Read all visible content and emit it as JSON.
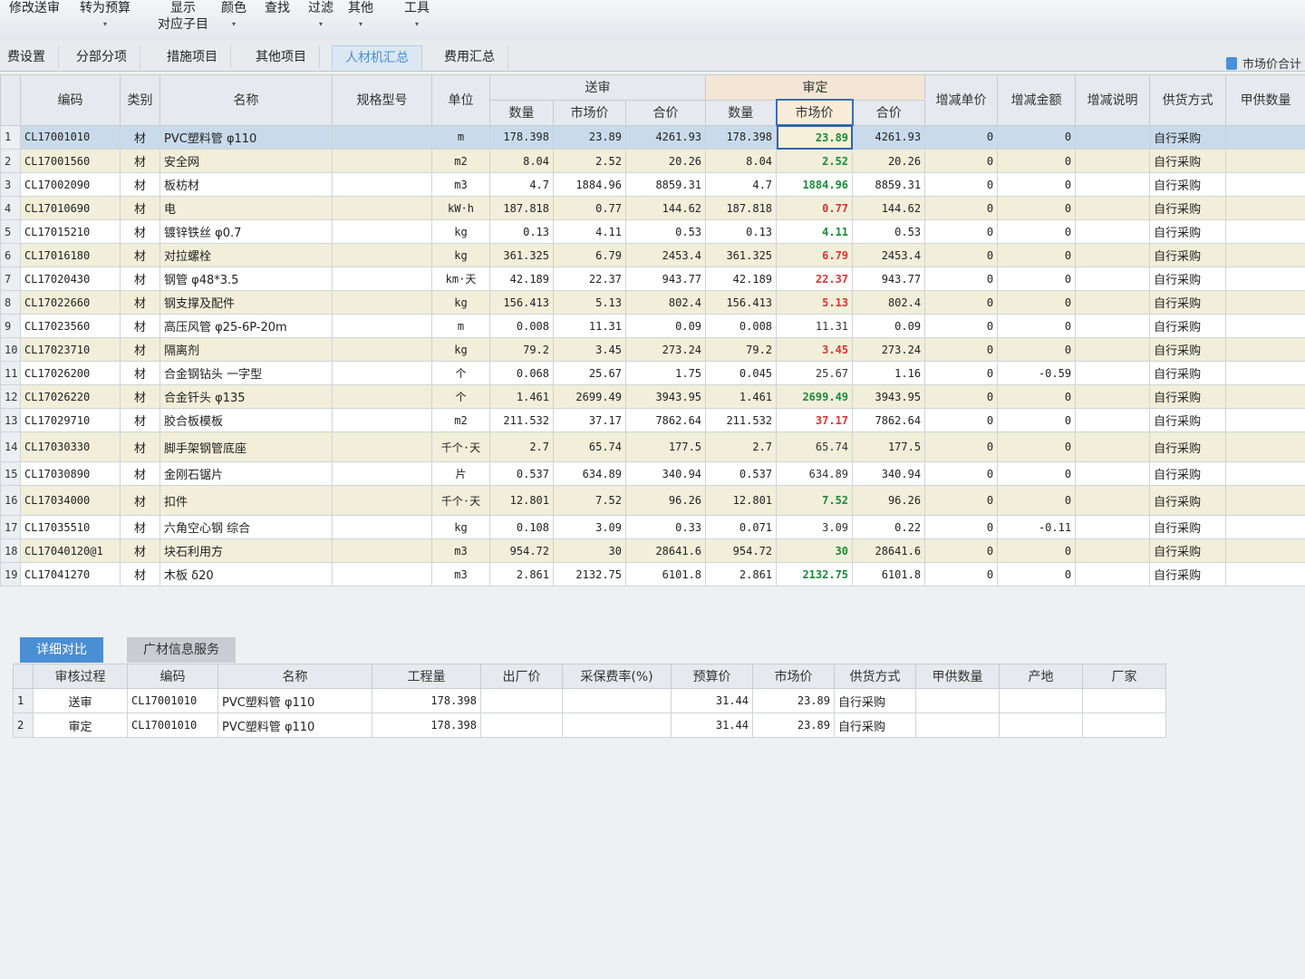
{
  "toolbar": {
    "items": [
      {
        "label": "修改送审",
        "caret": false
      },
      {
        "label": "转为预算",
        "caret": true
      },
      {
        "label": "显示\n对应子目",
        "caret": true
      },
      {
        "label": "颜色",
        "caret": true
      },
      {
        "label": "查找",
        "caret": false
      },
      {
        "label": "过滤",
        "caret": true
      },
      {
        "label": "其他",
        "caret": true
      },
      {
        "label": "工具",
        "caret": true
      }
    ]
  },
  "tabs": {
    "items": [
      "费设置",
      "分部分项",
      "措施项目",
      "其他项目",
      "人材机汇总",
      "费用汇总"
    ],
    "active_index": 4,
    "right_label": "市场价合计"
  },
  "grid": {
    "headers": {
      "code": "编码",
      "category": "类别",
      "name": "名称",
      "spec": "规格型号",
      "unit": "单位",
      "group_submitted": "送审",
      "group_approved": "审定",
      "qty": "数量",
      "market_price": "市场价",
      "total": "合价",
      "adj_unit_price": "增减单价",
      "adj_amount": "增减金额",
      "adj_note": "增减说明",
      "supply_mode": "供货方式",
      "owner_qty": "甲供数量"
    },
    "rows": [
      {
        "no": "1",
        "code": "CL17001010",
        "cat": "材",
        "name": "PVC塑料管 φ110",
        "unit": "m",
        "sq": "178.398",
        "sp": "23.89",
        "st": "4261.93",
        "aq": "178.398",
        "ap": "23.89",
        "at": "4261.93",
        "du": "0",
        "da": "0",
        "supply": "自行采购",
        "pc": "green"
      },
      {
        "no": "2",
        "code": "CL17001560",
        "cat": "材",
        "name": "安全网",
        "unit": "m2",
        "sq": "8.04",
        "sp": "2.52",
        "st": "20.26",
        "aq": "8.04",
        "ap": "2.52",
        "at": "20.26",
        "du": "0",
        "da": "0",
        "supply": "自行采购",
        "pc": "green"
      },
      {
        "no": "3",
        "code": "CL17002090",
        "cat": "材",
        "name": "板枋材",
        "unit": "m3",
        "sq": "4.7",
        "sp": "1884.96",
        "st": "8859.31",
        "aq": "4.7",
        "ap": "1884.96",
        "at": "8859.31",
        "du": "0",
        "da": "0",
        "supply": "自行采购",
        "pc": "green"
      },
      {
        "no": "4",
        "code": "CL17010690",
        "cat": "材",
        "name": "电",
        "unit": "kW·h",
        "sq": "187.818",
        "sp": "0.77",
        "st": "144.62",
        "aq": "187.818",
        "ap": "0.77",
        "at": "144.62",
        "du": "0",
        "da": "0",
        "supply": "自行采购",
        "pc": "red"
      },
      {
        "no": "5",
        "code": "CL17015210",
        "cat": "材",
        "name": "镀锌铁丝 φ0.7",
        "unit": "kg",
        "sq": "0.13",
        "sp": "4.11",
        "st": "0.53",
        "aq": "0.13",
        "ap": "4.11",
        "at": "0.53",
        "du": "0",
        "da": "0",
        "supply": "自行采购",
        "pc": "green"
      },
      {
        "no": "6",
        "code": "CL17016180",
        "cat": "材",
        "name": "对拉螺栓",
        "unit": "kg",
        "sq": "361.325",
        "sp": "6.79",
        "st": "2453.4",
        "aq": "361.325",
        "ap": "6.79",
        "at": "2453.4",
        "du": "0",
        "da": "0",
        "supply": "自行采购",
        "pc": "red"
      },
      {
        "no": "7",
        "code": "CL17020430",
        "cat": "材",
        "name": "钢管 φ48*3.5",
        "unit": "km·天",
        "sq": "42.189",
        "sp": "22.37",
        "st": "943.77",
        "aq": "42.189",
        "ap": "22.37",
        "at": "943.77",
        "du": "0",
        "da": "0",
        "supply": "自行采购",
        "pc": "red"
      },
      {
        "no": "8",
        "code": "CL17022660",
        "cat": "材",
        "name": "钢支撑及配件",
        "unit": "kg",
        "sq": "156.413",
        "sp": "5.13",
        "st": "802.4",
        "aq": "156.413",
        "ap": "5.13",
        "at": "802.4",
        "du": "0",
        "da": "0",
        "supply": "自行采购",
        "pc": "red"
      },
      {
        "no": "9",
        "code": "CL17023560",
        "cat": "材",
        "name": "高压风管 φ25-6P-20m",
        "unit": "m",
        "sq": "0.008",
        "sp": "11.31",
        "st": "0.09",
        "aq": "0.008",
        "ap": "11.31",
        "at": "0.09",
        "du": "0",
        "da": "0",
        "supply": "自行采购",
        "pc": "plain"
      },
      {
        "no": "10",
        "code": "CL17023710",
        "cat": "材",
        "name": "隔离剂",
        "unit": "kg",
        "sq": "79.2",
        "sp": "3.45",
        "st": "273.24",
        "aq": "79.2",
        "ap": "3.45",
        "at": "273.24",
        "du": "0",
        "da": "0",
        "supply": "自行采购",
        "pc": "red"
      },
      {
        "no": "11",
        "code": "CL17026200",
        "cat": "材",
        "name": "合金钢钻头 一字型",
        "unit": "个",
        "sq": "0.068",
        "sp": "25.67",
        "st": "1.75",
        "aq": "0.045",
        "ap": "25.67",
        "at": "1.16",
        "du": "0",
        "da": "-0.59",
        "supply": "自行采购",
        "pc": "plain"
      },
      {
        "no": "12",
        "code": "CL17026220",
        "cat": "材",
        "name": "合金钎头 φ135",
        "unit": "个",
        "sq": "1.461",
        "sp": "2699.49",
        "st": "3943.95",
        "aq": "1.461",
        "ap": "2699.49",
        "at": "3943.95",
        "du": "0",
        "da": "0",
        "supply": "自行采购",
        "pc": "green"
      },
      {
        "no": "13",
        "code": "CL17029710",
        "cat": "材",
        "name": "胶合板模板",
        "unit": "m2",
        "sq": "211.532",
        "sp": "37.17",
        "st": "7862.64",
        "aq": "211.532",
        "ap": "37.17",
        "at": "7862.64",
        "du": "0",
        "da": "0",
        "supply": "自行采购",
        "pc": "red"
      },
      {
        "no": "14",
        "code": "CL17030330",
        "cat": "材",
        "name": "脚手架钢管底座",
        "unit": "千个·天",
        "sq": "2.7",
        "sp": "65.74",
        "st": "177.5",
        "aq": "2.7",
        "ap": "65.74",
        "at": "177.5",
        "du": "0",
        "da": "0",
        "supply": "自行采购",
        "pc": "plain",
        "tall": true
      },
      {
        "no": "15",
        "code": "CL17030890",
        "cat": "材",
        "name": "金刚石锯片",
        "unit": "片",
        "sq": "0.537",
        "sp": "634.89",
        "st": "340.94",
        "aq": "0.537",
        "ap": "634.89",
        "at": "340.94",
        "du": "0",
        "da": "0",
        "supply": "自行采购",
        "pc": "plain"
      },
      {
        "no": "16",
        "code": "CL17034000",
        "cat": "材",
        "name": "扣件",
        "unit": "千个·天",
        "sq": "12.801",
        "sp": "7.52",
        "st": "96.26",
        "aq": "12.801",
        "ap": "7.52",
        "at": "96.26",
        "du": "0",
        "da": "0",
        "supply": "自行采购",
        "pc": "green",
        "tall": true
      },
      {
        "no": "17",
        "code": "CL17035510",
        "cat": "材",
        "name": "六角空心钢 综合",
        "unit": "kg",
        "sq": "0.108",
        "sp": "3.09",
        "st": "0.33",
        "aq": "0.071",
        "ap": "3.09",
        "at": "0.22",
        "du": "0",
        "da": "-0.11",
        "supply": "自行采购",
        "pc": "plain"
      },
      {
        "no": "18",
        "code": "CL17040120@1",
        "cat": "材",
        "name": "块石利用方",
        "unit": "m3",
        "sq": "954.72",
        "sp": "30",
        "st": "28641.6",
        "aq": "954.72",
        "ap": "30",
        "at": "28641.6",
        "du": "0",
        "da": "0",
        "supply": "自行采购",
        "pc": "green"
      },
      {
        "no": "19",
        "code": "CL17041270",
        "cat": "材",
        "name": "木板 δ20",
        "unit": "m3",
        "sq": "2.861",
        "sp": "2132.75",
        "st": "6101.8",
        "aq": "2.861",
        "ap": "2132.75",
        "at": "6101.8",
        "du": "0",
        "da": "0",
        "supply": "自行采购",
        "pc": "green"
      }
    ]
  },
  "bottom": {
    "tabs": [
      "详细对比",
      "广材信息服务"
    ],
    "headers": {
      "process": "审核过程",
      "code": "编码",
      "name": "名称",
      "qty": "工程量",
      "factory_price": "出厂价",
      "purchase_rate": "采保费率(%)",
      "budget_price": "预算价",
      "market_price": "市场价",
      "supply_mode": "供货方式",
      "owner_qty": "甲供数量",
      "origin": "产地",
      "manufacturer": "厂家"
    },
    "rows": [
      {
        "no": "1",
        "process": "送审",
        "code": "CL17001010",
        "name": "PVC塑料管 φ110",
        "qty": "178.398",
        "budget": "31.44",
        "market": "23.89",
        "supply": "自行采购"
      },
      {
        "no": "2",
        "process": "审定",
        "code": "CL17001010",
        "name": "PVC塑料管 φ110",
        "qty": "178.398",
        "budget": "31.44",
        "market": "23.89",
        "supply": "自行采购"
      }
    ]
  },
  "colors": {
    "accent": "#4a8fd4",
    "price_up": "#d33333",
    "price_down": "#1c8a3a",
    "row_alt": "#f1efd9",
    "selected_row": "#c9dbeb"
  }
}
